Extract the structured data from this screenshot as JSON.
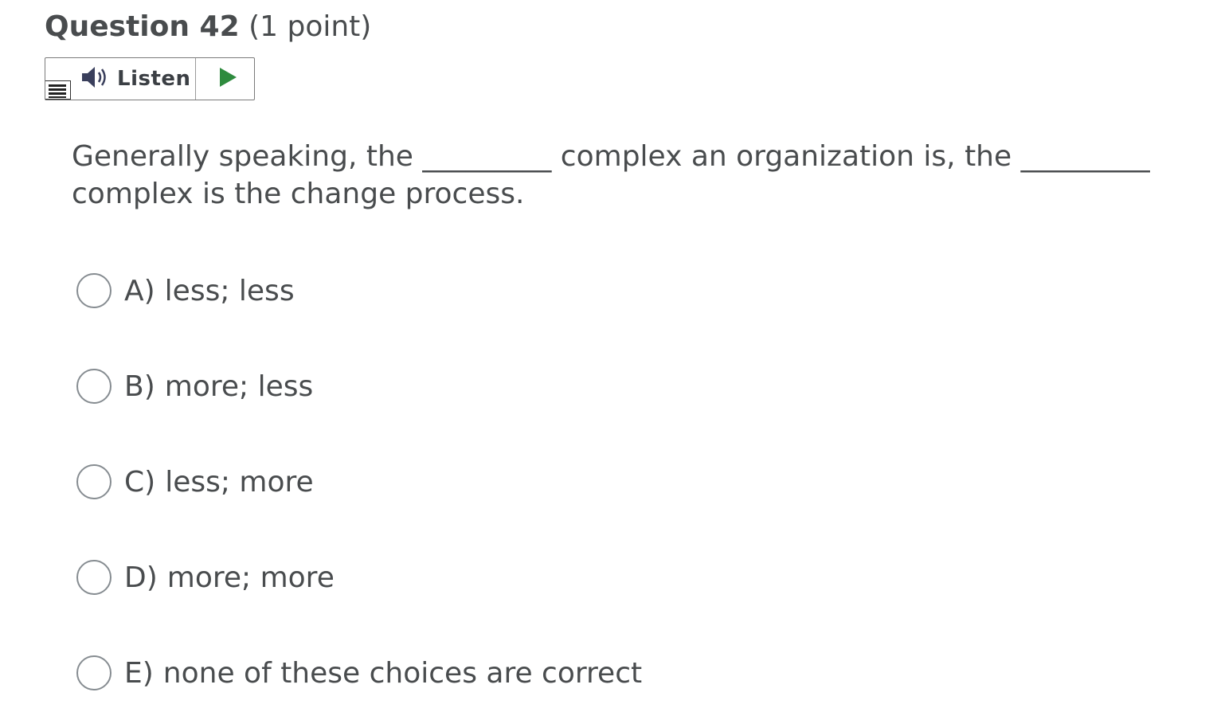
{
  "question": {
    "title": "Question 42",
    "points": "(1 point)",
    "text": "Generally speaking, the _________ complex an organization is, the _________ complex is the change process."
  },
  "listen": {
    "label": "Listen",
    "speaker_icon": "speaker-icon",
    "play_icon": "play-icon",
    "menu_icon": "menu-icon",
    "play_color": "#2e8b3e"
  },
  "options": [
    {
      "letter": "A)",
      "text": "less; less"
    },
    {
      "letter": "B)",
      "text": "more; less"
    },
    {
      "letter": "C)",
      "text": "less; more"
    },
    {
      "letter": "D)",
      "text": "more; more"
    },
    {
      "letter": "E)",
      "text": "none of these choices are correct"
    }
  ]
}
